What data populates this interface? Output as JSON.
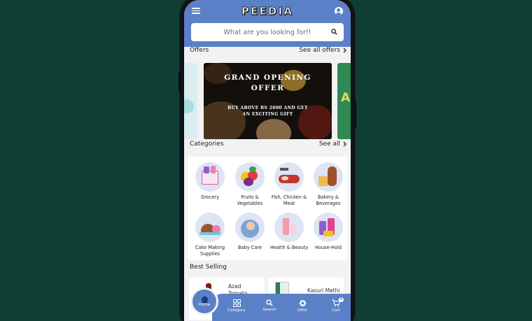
{
  "app": {
    "brand": "PEEDIA"
  },
  "search": {
    "placeholder": "What are you looking for!!"
  },
  "offers": {
    "title": "Offers",
    "see_all": "See all offers",
    "banner": {
      "line1": "GRAND OPENING",
      "line2": "OFFER",
      "line3": "BUY ABOVE RS 2000 AND GET AN EXCITING GIFT"
    },
    "peek_right_text": "A"
  },
  "categories": {
    "title": "Categories",
    "see_all": "See all",
    "items": [
      {
        "label": "Grocery"
      },
      {
        "label": "Fruits & Vegetables"
      },
      {
        "label": "Fish, Chicken & Meat"
      },
      {
        "label": "Bakery & Beverages"
      },
      {
        "label": "Cake Making Supplies"
      },
      {
        "label": "Baby Care"
      },
      {
        "label": "Health & Beauty"
      },
      {
        "label": "House-Hold"
      }
    ]
  },
  "best_selling": {
    "title": "Best Selling",
    "items": [
      {
        "name": "Azad Tomato"
      },
      {
        "name": "Kasuri Methi"
      }
    ]
  },
  "bottom_nav": {
    "home": "Home",
    "category": "Category",
    "search": "Search",
    "offer": "Offer",
    "cart": "Cart",
    "cart_count": "0"
  },
  "colors": {
    "primary": "#5a80c7",
    "background": "#0f3f34",
    "screen": "#f2f2f3"
  },
  "icons": [
    "menu-icon",
    "account-icon",
    "search-icon",
    "chevron-right-icon",
    "home-icon",
    "category-grid-icon",
    "offer-badge-icon",
    "cart-icon"
  ]
}
